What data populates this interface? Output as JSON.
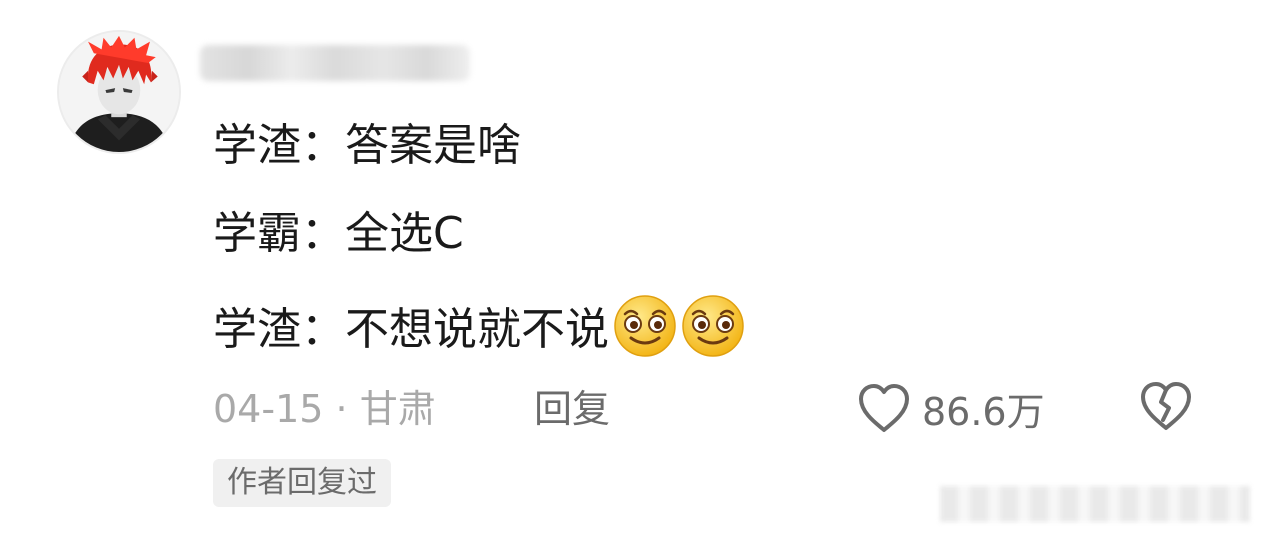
{
  "comment": {
    "user": {
      "avatar_icon": "avatar-red-hair-anime-boy",
      "name": ""
    },
    "lines": [
      {
        "speaker": "学渣：",
        "text": "答案是啥"
      },
      {
        "speaker": "学霸：",
        "text": "全选C"
      },
      {
        "speaker": "学渣：",
        "text": "不想说就不说",
        "emojis": [
          "smile-emoji",
          "smile-emoji"
        ]
      }
    ],
    "meta": {
      "date": "04-15",
      "separator": "·",
      "location": "甘肃"
    },
    "actions": {
      "reply_label": "回复",
      "like_icon": "heart-outline-icon",
      "like_count": "86.6万",
      "dislike_icon": "broken-heart-icon"
    },
    "author_tag": "作者回复过"
  },
  "colors": {
    "text_primary": "#1a1a1a",
    "text_meta": "#a9a9a9",
    "text_action": "#6b6b6b",
    "tag_background": "#f0f0f0"
  }
}
